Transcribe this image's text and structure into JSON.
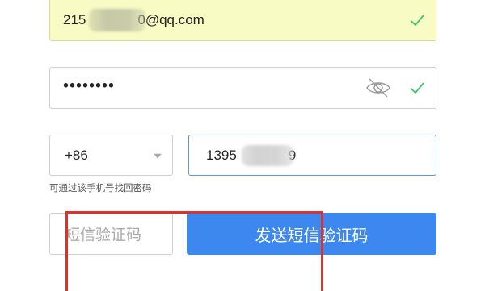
{
  "email": {
    "value_start": "215",
    "value_end": "0@qq.com",
    "status_icon": "check-icon"
  },
  "password": {
    "value": "••••••••",
    "toggle_icon": "eye-slash-icon",
    "status_icon": "check-icon"
  },
  "country": {
    "selected": "+86",
    "arrow_icon": "chevron-down-icon"
  },
  "phone": {
    "value_start": "1395",
    "value_end": "9"
  },
  "hint": "可通过该手机号找回密码",
  "sms": {
    "placeholder": "短信验证码",
    "send_label": "发送短信验证码"
  },
  "colors": {
    "accent": "#3c88ee",
    "success": "#3fc46a",
    "autofill": "#f8fbc4",
    "annotation": "#e0302c"
  }
}
